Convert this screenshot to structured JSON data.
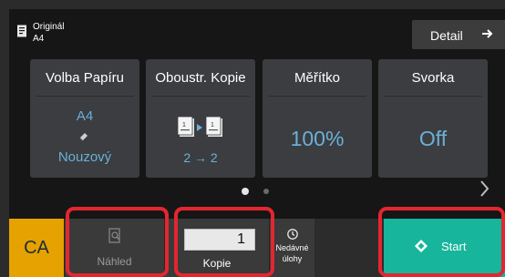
{
  "header": {
    "original_label": "Originál",
    "original_size": "A4",
    "detail_label": "Detail"
  },
  "cards": [
    {
      "title": "Volba Papíru",
      "size": "A4",
      "mode": "Nouzový"
    },
    {
      "title": "Oboustr. Kopie",
      "mode": "2 → 2"
    },
    {
      "title": "Měřítko",
      "value": "100%"
    },
    {
      "title": "Svorka",
      "value": "Off"
    }
  ],
  "pager": {
    "total_pages": 2,
    "current_page": 1
  },
  "bottom": {
    "ca_label": "CA",
    "preview_label": "Náhled",
    "copies_value": "1",
    "copies_label": "Kopie",
    "recent_line1": "Nedávné",
    "recent_line2": "úlohy",
    "start_label": "Start"
  },
  "colors": {
    "accent_value": "#6ab0d8",
    "ca": "#e5a200",
    "start": "#17b59b",
    "highlight": "#e3262f",
    "card_bg": "#3b3d40"
  },
  "icons": [
    "document-icon",
    "arrow-right-icon",
    "paper-tray-icon",
    "duplex-icon",
    "chevron-right-icon",
    "preview-icon",
    "history-icon",
    "start-diamond-icon"
  ]
}
